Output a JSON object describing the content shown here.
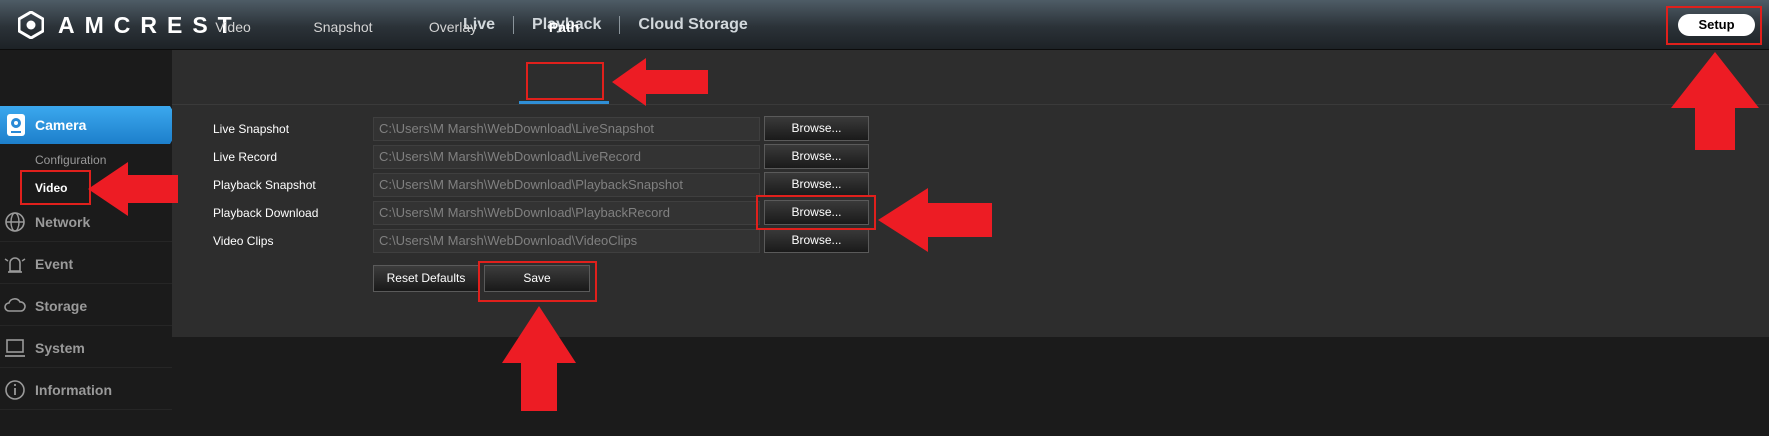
{
  "brand": {
    "name": "AMCREST"
  },
  "topnav": {
    "items": [
      "Live",
      "Playback",
      "Cloud Storage"
    ],
    "setup_label": "Setup"
  },
  "tabs": [
    "Video",
    "Snapshot",
    "Overlay",
    "Path"
  ],
  "active_tab": "Path",
  "sidebar": {
    "camera": {
      "label": "Camera",
      "subitems": [
        "Configuration",
        "Video"
      ],
      "active_subitem": "Video"
    },
    "items": [
      {
        "label": "Network",
        "icon": "globe-icon"
      },
      {
        "label": "Event",
        "icon": "alarm-icon"
      },
      {
        "label": "Storage",
        "icon": "cloud-icon"
      },
      {
        "label": "System",
        "icon": "computer-icon"
      },
      {
        "label": "Information",
        "icon": "info-icon"
      }
    ]
  },
  "paths": [
    {
      "label": "Live Snapshot",
      "value": "C:\\Users\\M Marsh\\WebDownload\\LiveSnapshot",
      "button": "Browse..."
    },
    {
      "label": "Live Record",
      "value": "C:\\Users\\M Marsh\\WebDownload\\LiveRecord",
      "button": "Browse..."
    },
    {
      "label": "Playback Snapshot",
      "value": "C:\\Users\\M Marsh\\WebDownload\\PlaybackSnapshot",
      "button": "Browse..."
    },
    {
      "label": "Playback Download",
      "value": "C:\\Users\\M Marsh\\WebDownload\\PlaybackRecord",
      "button": "Browse..."
    },
    {
      "label": "Video Clips",
      "value": "C:\\Users\\M Marsh\\WebDownload\\VideoClips",
      "button": "Browse..."
    }
  ],
  "actions": {
    "reset_label": "Reset Defaults",
    "save_label": "Save"
  },
  "colors": {
    "accent": "#2f8fd6",
    "annotation": "#e0201c",
    "panel": "#2d2d2d",
    "background": "#1b1b1b"
  }
}
